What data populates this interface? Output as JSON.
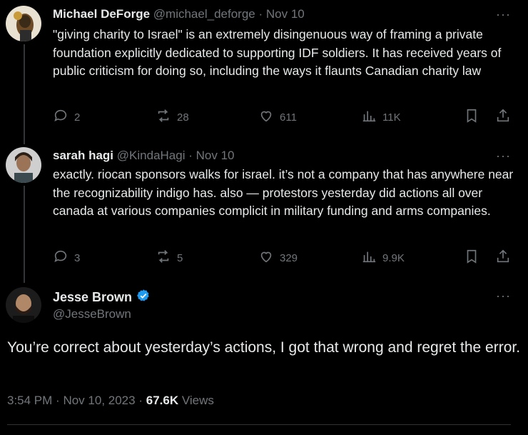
{
  "tweets": [
    {
      "name": "Michael DeForge",
      "handle": "@michael_deforge",
      "dot": "·",
      "date": "Nov 10",
      "text": "\"giving charity to Israel\" is an extremely disingenuous way of framing a private foundation explicitly dedicated to supporting IDF soldiers. It has received years of public criticism for doing so, including the ways it flaunts Canadian charity law",
      "replies": "2",
      "reposts": "28",
      "likes": "611",
      "views": "11K"
    },
    {
      "name": "sarah hagi",
      "handle": "@KindaHagi",
      "dot": "·",
      "date": "Nov 10",
      "text": "exactly. riocan sponsors walks for israel. it’s not a company that has anywhere near the recognizability indigo has. also — protestors yesterday did actions all over canada at various companies complicit in military funding and arms companies.",
      "replies": "3",
      "reposts": "5",
      "likes": "329",
      "views": "9.9K"
    }
  ],
  "main_tweet": {
    "name": "Jesse Brown",
    "verified": true,
    "handle": "@JesseBrown",
    "text": "You’re correct about yesterday’s actions, I got that wrong and regret the error.",
    "time": "3:54 PM",
    "sep1": "·",
    "date": "Nov 10, 2023",
    "sep2": "·",
    "views": "67.6K",
    "views_label": "Views"
  },
  "more_glyph": "···",
  "colors": {
    "background": "#000000",
    "text": "#e7e9ea",
    "muted": "#71767b",
    "verified": "#1d9bf0",
    "thread_line": "#333639"
  }
}
